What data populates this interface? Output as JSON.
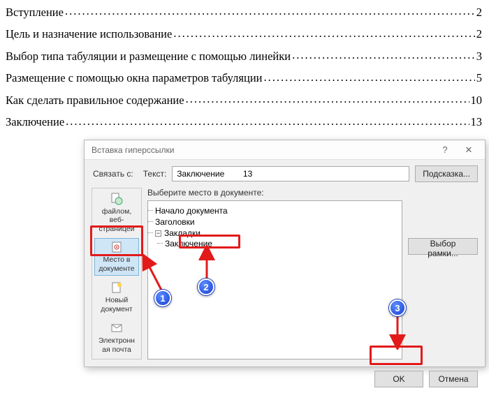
{
  "toc": {
    "items": [
      {
        "title": "Вступление",
        "page": "2"
      },
      {
        "title": "Цель и назначение использование",
        "page": "2"
      },
      {
        "title": "Выбор типа табуляции и размещение с помощью линейки",
        "page": "3"
      },
      {
        "title": "Размещение с помощью окна параметров табуляции",
        "page": "5"
      },
      {
        "title": "Как сделать правильное содержание",
        "page": "10"
      },
      {
        "title": "Заключение",
        "page": "13"
      }
    ]
  },
  "dialog": {
    "title": "Вставка гиперссылки",
    "help_symbol": "?",
    "close_symbol": "✕",
    "link_label": "Связать с:",
    "text_label": "Текст:",
    "text_value": "Заключение        13",
    "hint_button": "Подсказка...",
    "pick_label": "Выберите место в документе:",
    "frame_button": "Выбор рамки...",
    "ok_button": "OK",
    "cancel_button": "Отмена",
    "sidebar": {
      "items": [
        {
          "label": "файлом,\nвеб-\nстраницей",
          "selected": false
        },
        {
          "label": "Место в\nдокументе",
          "selected": true
        },
        {
          "label": "Новый\nдокумент",
          "selected": false
        },
        {
          "label": "Электронн\nая почта",
          "selected": false
        }
      ]
    },
    "tree": {
      "root0": "Начало документа",
      "root1": "Заголовки",
      "root2": "Закладки",
      "bookmark0": "Заключение",
      "minus": "−"
    }
  },
  "callouts": {
    "n1": "1",
    "n2": "2",
    "n3": "3"
  }
}
